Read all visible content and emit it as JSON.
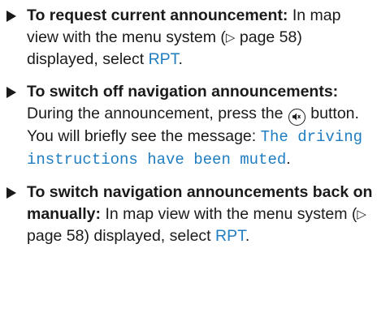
{
  "items": [
    {
      "lead": "To request current announcement:",
      "t1": " In map view with the menu system (",
      "pageref_icon": "▷",
      "pageref": " page 58",
      "t2": ") displayed, select ",
      "code": "RPT",
      "t3": "."
    },
    {
      "lead": "To switch off navigation announcements:",
      "t1": " During the announcement, press the ",
      "mute_icon": "mute-button-icon",
      "t2": " button. You will briefly see the message: ",
      "code": "The driving instructions have been muted",
      "t3": "."
    },
    {
      "lead": "To switch navigation announcements back on manually:",
      "t1": " In map view with the menu system (",
      "pageref_icon": "▷",
      "pageref": " page 58",
      "t2": ") displayed, select ",
      "code": "RPT",
      "t3": "."
    }
  ]
}
